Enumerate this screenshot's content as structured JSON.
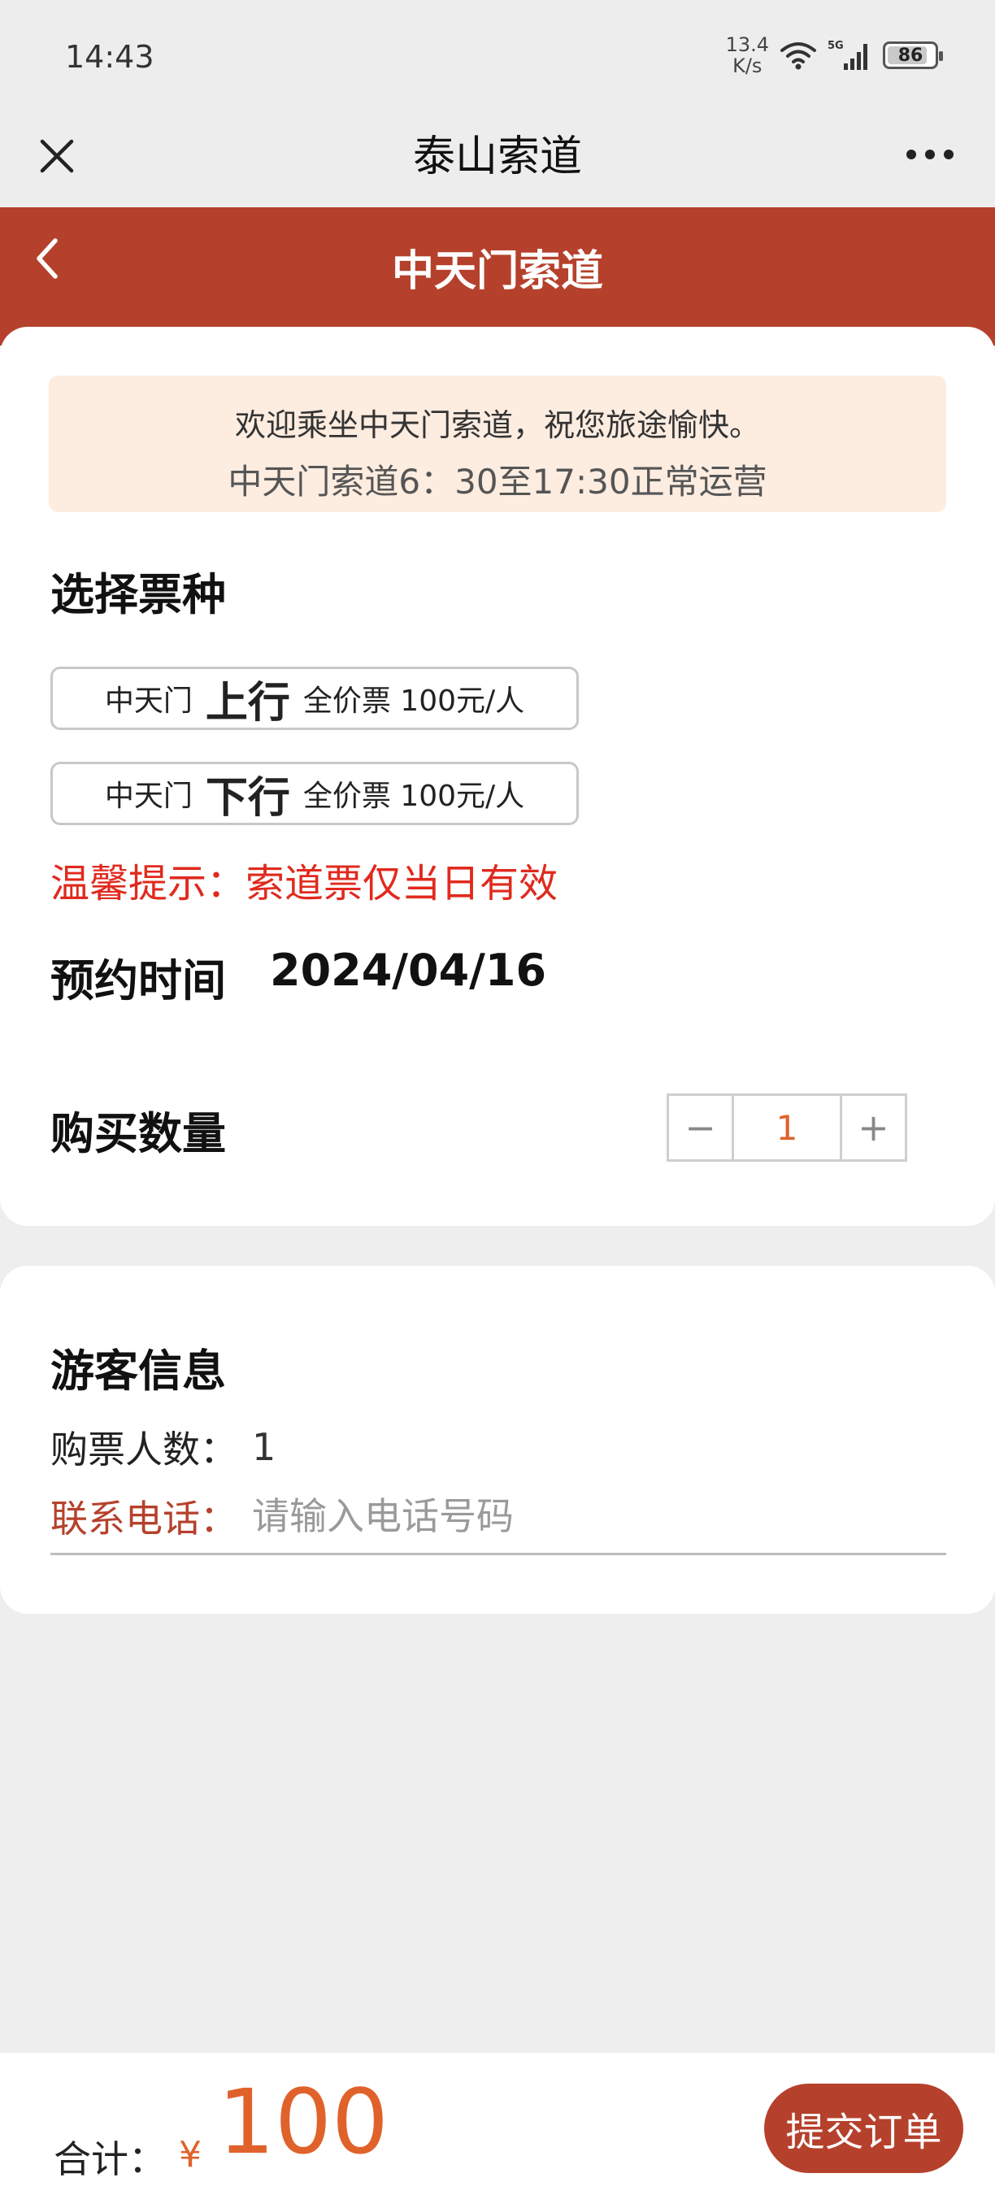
{
  "status_bar": {
    "time": "14:43",
    "net_speed_value": "13.4",
    "net_speed_unit": "K/s",
    "network_type": "5G",
    "battery": "86",
    "battery_level": 0.86
  },
  "navbar": {
    "title": "泰山索道"
  },
  "header": {
    "title": "中天门索道"
  },
  "notice": {
    "line1": "欢迎乘坐中天门索道，祝您旅途愉快。",
    "line2": "中天门索道6：30至17:30正常运营"
  },
  "ticket_section": {
    "title": "选择票种",
    "options": [
      {
        "station": "中天门",
        "direction": "上行",
        "price": "全价票 100元/人"
      },
      {
        "station": "中天门",
        "direction": "下行",
        "price": "全价票 100元/人"
      }
    ],
    "tip": "温馨提示：索道票仅当日有效"
  },
  "reservation": {
    "label": "预约时间",
    "date": "2024/04/16"
  },
  "quantity": {
    "label": "购买数量",
    "minus": "−",
    "value": "1",
    "plus": "+"
  },
  "visitor": {
    "title": "游客信息",
    "count_label": "购票人数：",
    "count_value": "1",
    "phone_label": "联系电话：",
    "phone_placeholder": "请输入电话号码",
    "phone_value": ""
  },
  "footer": {
    "total_label": "合计：",
    "currency": "¥",
    "total_amount": "100",
    "submit_label": "提交订单"
  },
  "colors": {
    "brand_red": "#b5412c",
    "accent_orange": "#e0622b",
    "tip_red": "#e02a1e",
    "notice_bg": "#fdece0",
    "page_bg": "#eeeeee"
  },
  "icons": {
    "close": "close-icon",
    "more": "more-icon",
    "back": "chevron-left-icon",
    "wifi": "wifi-icon",
    "signal": "signal-icon",
    "battery": "battery-icon"
  }
}
